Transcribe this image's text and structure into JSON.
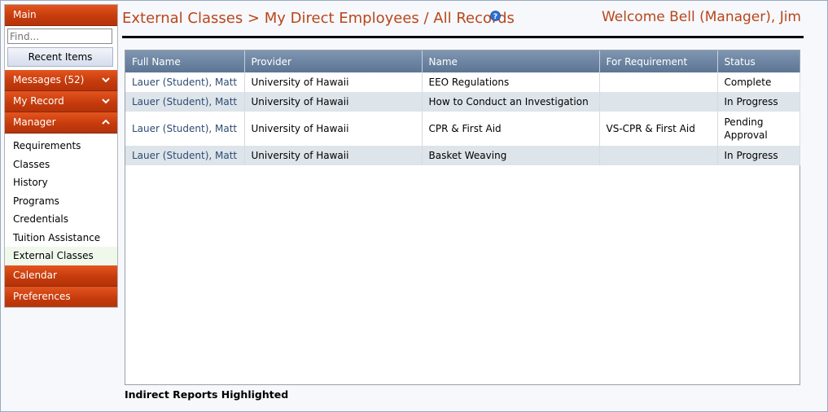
{
  "sidebar": {
    "main_label": "Main",
    "search_placeholder": "Find...",
    "recent_label": "Recent Items",
    "messages_label": "Messages (52)",
    "my_record_label": "My Record",
    "manager_label": "Manager",
    "manager_items": [
      "Requirements",
      "Classes",
      "History",
      "Programs",
      "Credentials",
      "Tuition Assistance",
      "External Classes"
    ],
    "calendar_label": "Calendar",
    "preferences_label": "Preferences"
  },
  "header": {
    "title": "External Classes > My Direct Employees / All Records",
    "welcome": "Welcome Bell (Manager), Jim"
  },
  "grid": {
    "columns": [
      "Full Name",
      "Provider",
      "Name",
      "For Requirement",
      "Status"
    ],
    "rows": [
      {
        "full_name": "Lauer (Student), Matt",
        "provider": "University of Hawaii",
        "name": "EEO Regulations",
        "requirement": "",
        "status": "Complete"
      },
      {
        "full_name": "Lauer (Student), Matt",
        "provider": "University of Hawaii",
        "name": "How to Conduct an Investigation",
        "requirement": "",
        "status": "In Progress"
      },
      {
        "full_name": "Lauer (Student), Matt",
        "provider": "University of Hawaii",
        "name": "CPR & First Aid",
        "requirement": "VS-CPR & First Aid",
        "status": "Pending Approval"
      },
      {
        "full_name": "Lauer (Student), Matt",
        "provider": "University of Hawaii",
        "name": "Basket Weaving",
        "requirement": "",
        "status": "In Progress"
      }
    ]
  },
  "footer": {
    "note": "Indirect Reports Highlighted"
  },
  "colors": {
    "accent": "#c63c0c",
    "title": "#b9461a",
    "grid_header": "#6b84a2"
  }
}
